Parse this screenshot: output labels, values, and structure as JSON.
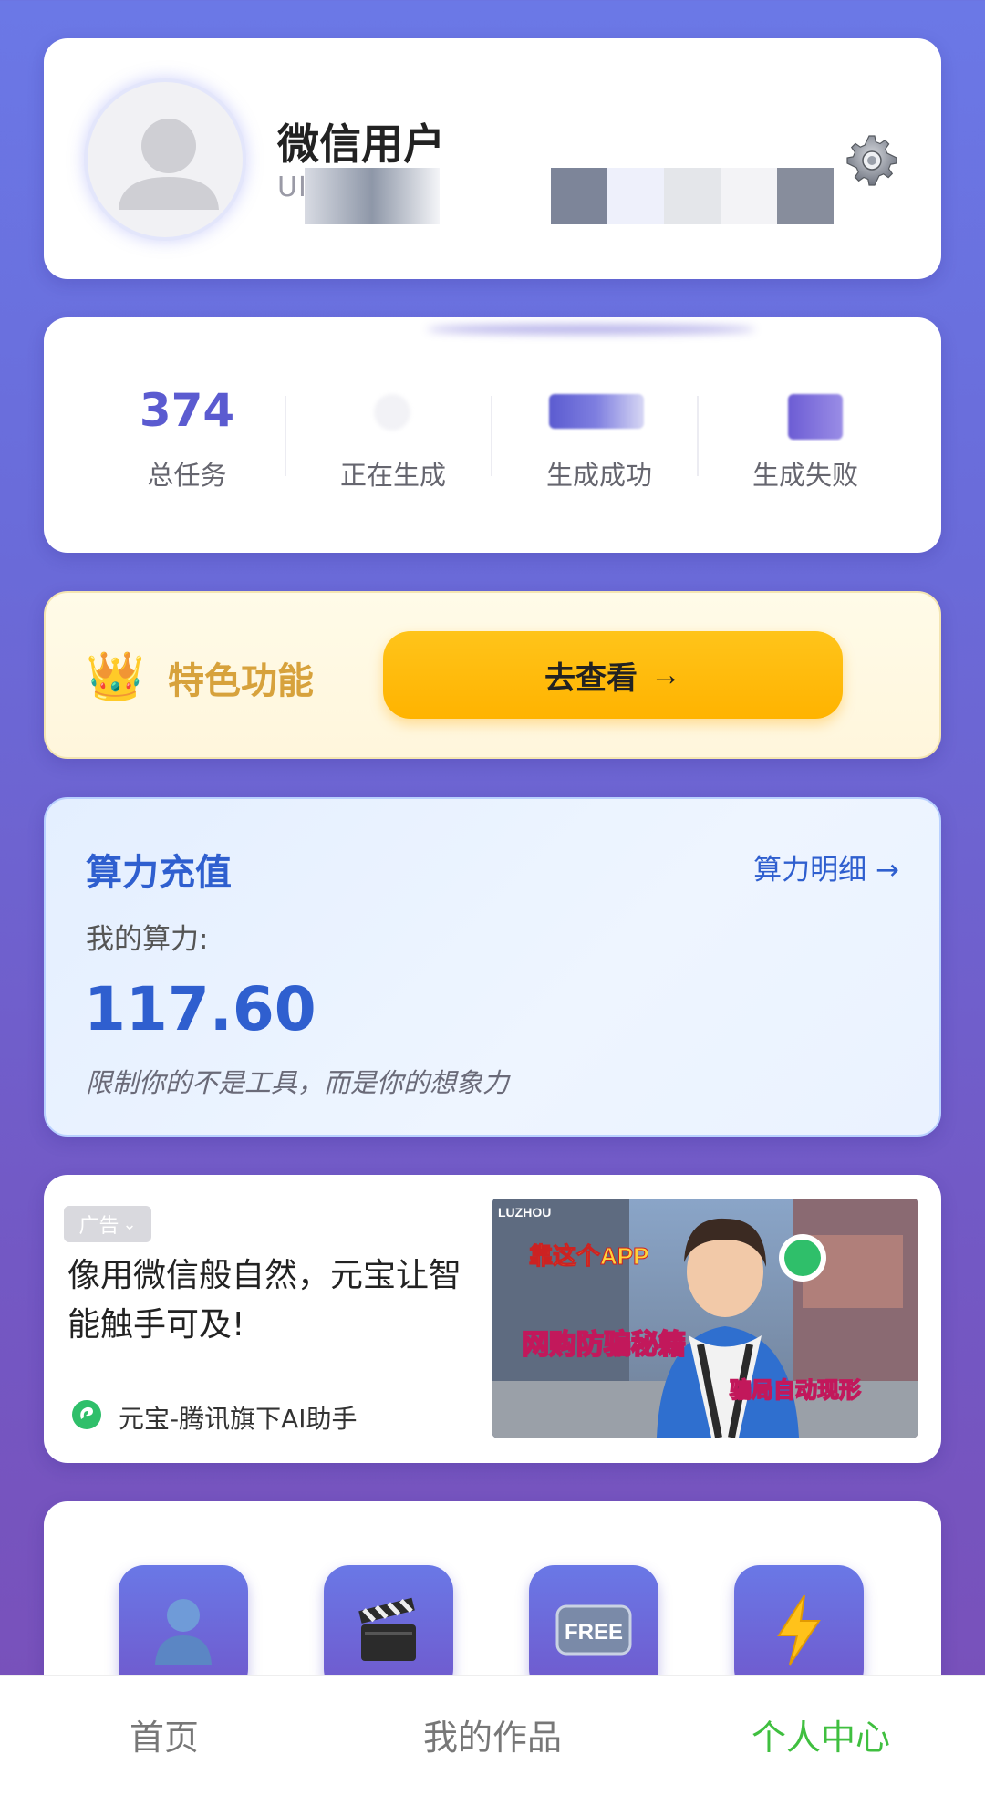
{
  "profile": {
    "user_name": "微信用户",
    "user_id": "UI                                   ckLI"
  },
  "stats": [
    {
      "value": "374",
      "label": "总任务"
    },
    {
      "value": "",
      "label": "正在生成"
    },
    {
      "value": "",
      "label": "生成成功"
    },
    {
      "value": "",
      "label": "生成失败"
    }
  ],
  "feature": {
    "title": "特色功能",
    "button_label": "去查看",
    "button_arrow": "→"
  },
  "power": {
    "title": "算力充值",
    "detail_link": "算力明细 →",
    "my_power_label": "我的算力:",
    "my_power_value": "117.60",
    "slogan": "限制你的不是工具，而是你的想象力"
  },
  "ad": {
    "badge": "广告",
    "badge_chevron": "⌄",
    "text": "像用微信般自然，元宝让智能触手可及!",
    "brand": "元宝-腾讯旗下AI助手",
    "image_texts": {
      "line1": "靠这个APP",
      "line2": "网购防骗秘籍",
      "line3": "骗局自动现形",
      "sign": "LUZHOU"
    }
  },
  "tools": [
    {
      "icon": "avatar-icon"
    },
    {
      "icon": "clapperboard-icon"
    },
    {
      "icon": "free-icon",
      "label": "FREE"
    },
    {
      "icon": "lightning-icon"
    }
  ],
  "nav": {
    "home": "首页",
    "works": "我的作品",
    "profile": "个人中心"
  },
  "colors": {
    "accent_blue": "#2f5fcf",
    "stat_purple": "#5b5bd0",
    "gold": "#ffb300",
    "nav_active": "#3fbf3f"
  }
}
